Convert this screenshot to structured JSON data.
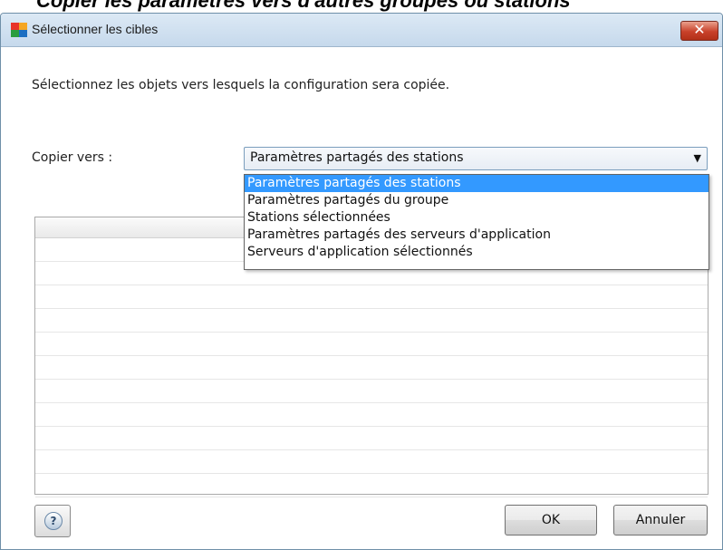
{
  "header_strip": {
    "text": "Copier les paramètres vers d'autres groupes ou stations"
  },
  "window": {
    "title": "Sélectionner les cibles",
    "close_symbol": "✕"
  },
  "instruction": "Sélectionnez les objets vers lesquels la configuration sera copiée.",
  "copy_to": {
    "label": "Copier vers :",
    "selected": "Paramètres partagés des stations",
    "options": [
      "Paramètres partagés des stations",
      "Paramètres partagés du groupe",
      "Stations sélectionnées",
      "Paramètres partagés des serveurs d'application",
      "Serveurs d'application sélectionnés"
    ]
  },
  "buttons": {
    "help": "?",
    "ok": "OK",
    "cancel": "Annuler"
  },
  "colors": {
    "selection": "#3399ff",
    "close_button": "#c8412a"
  }
}
